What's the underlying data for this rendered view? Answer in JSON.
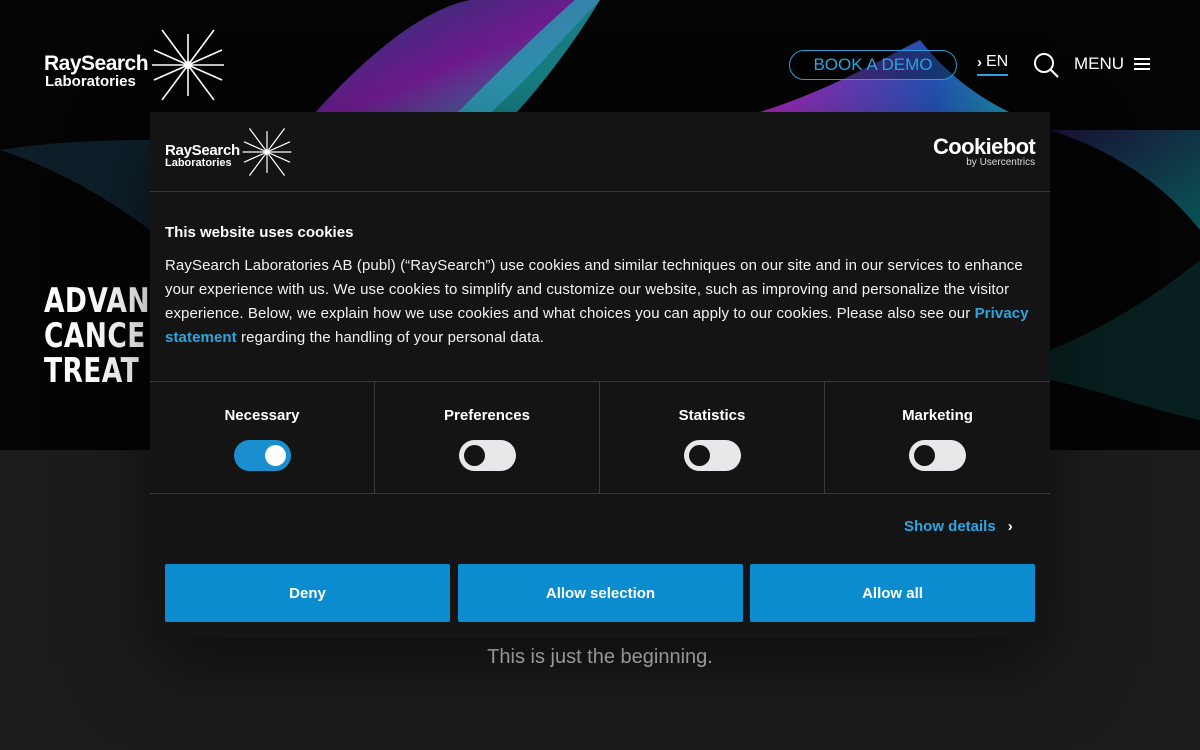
{
  "header": {
    "logo_line1": "RaySearch",
    "logo_line2": "Laboratories",
    "book_demo": "BOOK A DEMO",
    "language": "EN",
    "menu": "MENU",
    "icons": [
      "star-burst-logo-icon",
      "chevron-right-icon",
      "search-icon",
      "hamburger-icon"
    ]
  },
  "hero": {
    "headline_line1": "ADVAN",
    "headline_line2": "CANCE",
    "headline_line3": "TREAT"
  },
  "tagline": "This is just the beginning.",
  "cookie_dialog": {
    "logo_line1": "RaySearch",
    "logo_line2": "Laboratories",
    "cookiebot_brand": "Cookiebot",
    "cookiebot_sub": "by Usercentrics",
    "title": "This website uses cookies",
    "text_before_link": "RaySearch Laboratories AB (publ) (“RaySearch”) use cookies and similar techniques on our site and in our services to enhance your experience with us. We use cookies to simplify and customize our website, such as improving and personalize the visitor experience. Below, we explain how we use cookies and what choices you can apply to our cookies. Please also see our ",
    "link_text": "Privacy statement",
    "text_after_link": " regarding the handling of your personal data.",
    "categories": [
      {
        "label": "Necessary",
        "enabled": true
      },
      {
        "label": "Preferences",
        "enabled": false
      },
      {
        "label": "Statistics",
        "enabled": false
      },
      {
        "label": "Marketing",
        "enabled": false
      }
    ],
    "show_details": "Show details",
    "buttons": {
      "deny": "Deny",
      "allow_selection": "Allow selection",
      "allow_all": "Allow all"
    }
  },
  "colors": {
    "accent": "#0b8ccf",
    "link": "#2aa6e0",
    "background": "#040405",
    "dialog": "#141415"
  }
}
